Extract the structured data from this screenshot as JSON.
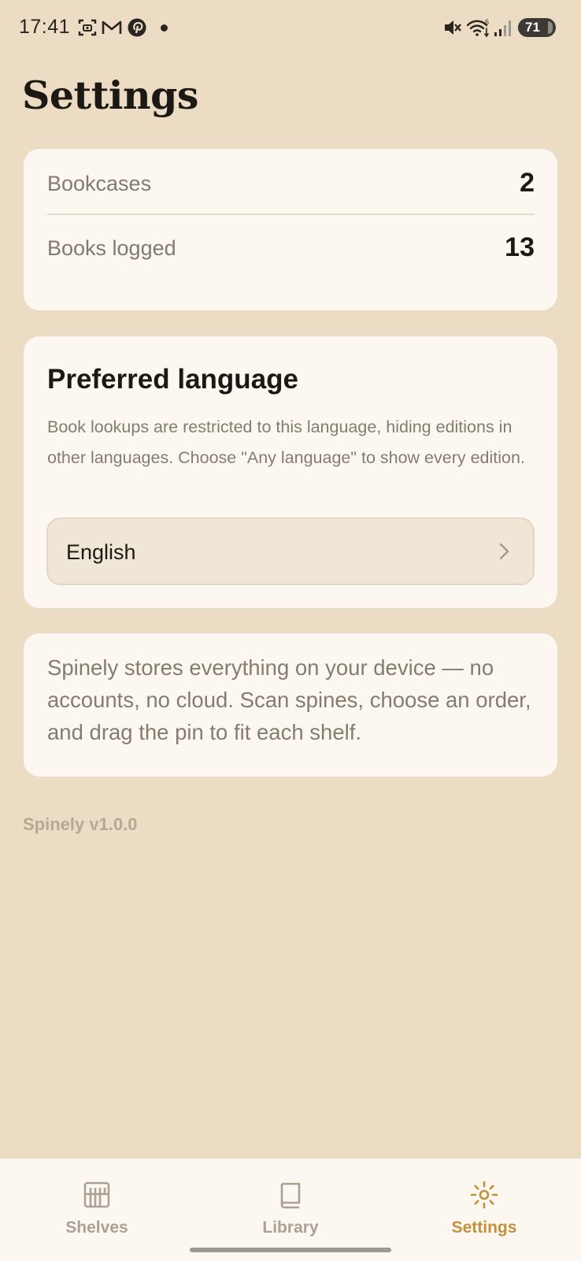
{
  "status_bar": {
    "time": "17:41",
    "battery": "71",
    "icons": [
      "face-scan-icon",
      "gmail-icon",
      "pinterest-icon",
      "notification-dot",
      "mute-icon",
      "wifi-icon",
      "signal-icon",
      "battery-icon"
    ]
  },
  "header": {
    "title": "Settings"
  },
  "stats": [
    {
      "label": "Bookcases",
      "value": "2"
    },
    {
      "label": "Books logged",
      "value": "13"
    }
  ],
  "language": {
    "title": "Preferred language",
    "description": "Book lookups are restricted to this language, hiding editions in other languages. Choose \"Any language\" to show every edition.",
    "selected": "English"
  },
  "about": {
    "text": "Spinely stores everything on your device — no accounts, no cloud. Scan spines, choose an order, and drag the pin to fit each shelf."
  },
  "version": "Spinely v1.0.0",
  "nav": {
    "items": [
      {
        "label": "Shelves",
        "icon": "shelves-icon",
        "active": false
      },
      {
        "label": "Library",
        "icon": "book-icon",
        "active": false
      },
      {
        "label": "Settings",
        "icon": "gear-icon",
        "active": true
      }
    ]
  },
  "colors": {
    "background": "#ebdcc3",
    "card": "#fcf8f1",
    "accent": "#c2913a",
    "muted_text": "#857c70"
  }
}
